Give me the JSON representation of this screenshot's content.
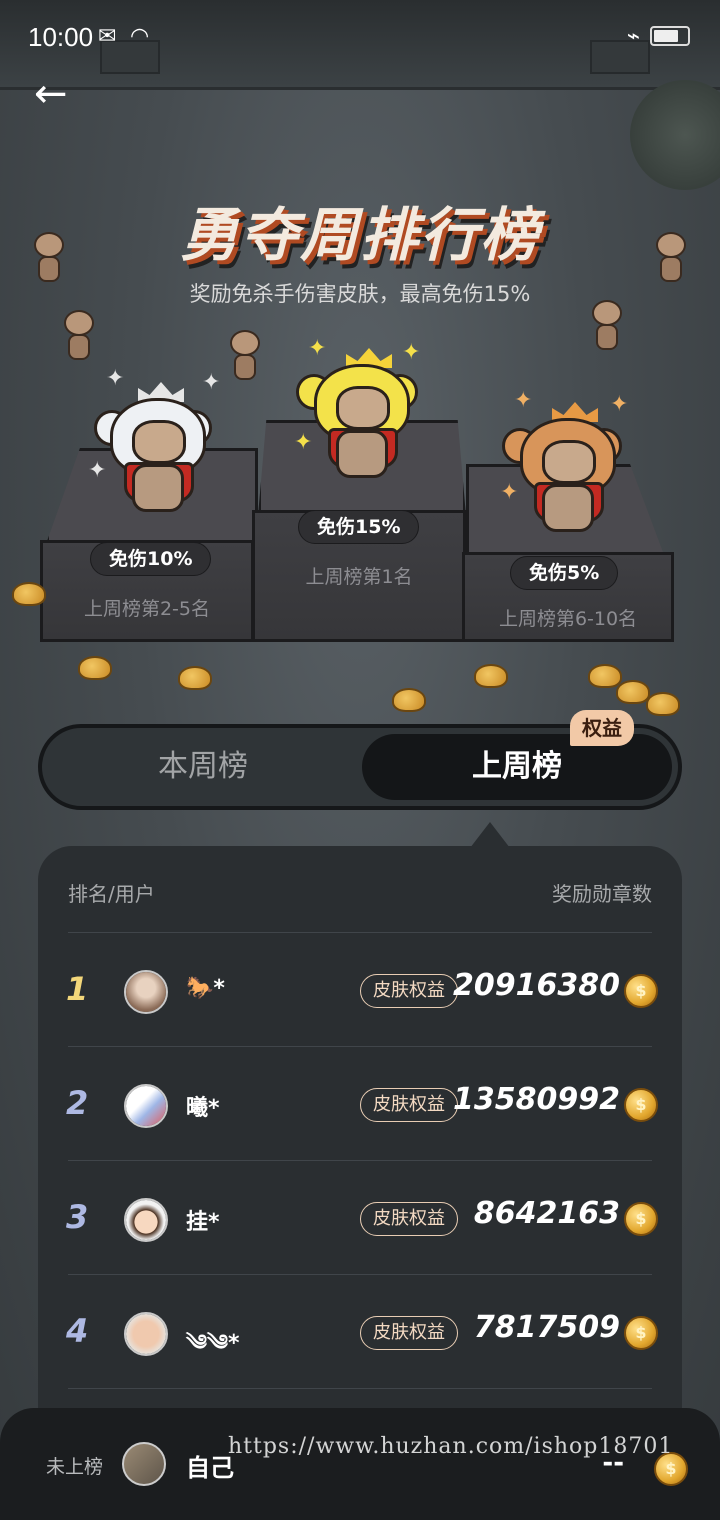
{
  "status_bar": {
    "time": "10:00"
  },
  "hero": {
    "title": "勇夺周排行榜",
    "subtitle": "奖励免杀手伤害皮肤，最高免伤15%"
  },
  "podium": [
    {
      "badge": "免伤10%",
      "caption": "上周榜第2-5名"
    },
    {
      "badge": "免伤15%",
      "caption": "上周榜第1名"
    },
    {
      "badge": "免伤5%",
      "caption": "上周榜第6-10名"
    }
  ],
  "tabs": {
    "this_week": "本周榜",
    "last_week": "上周榜",
    "badge": "权益"
  },
  "table": {
    "header_left": "排名/用户",
    "header_right": "奖励勋章数",
    "rows": [
      {
        "rank": "1",
        "name": "🐎*",
        "tag": "皮肤权益",
        "score": "20916380"
      },
      {
        "rank": "2",
        "name": "曦*",
        "tag": "皮肤权益",
        "score": "13580992"
      },
      {
        "rank": "3",
        "name": "挂*",
        "tag": "皮肤权益",
        "score": "8642163"
      },
      {
        "rank": "4",
        "name": "༄༄*",
        "tag": "皮肤权益",
        "score": "7817509"
      }
    ]
  },
  "self": {
    "status": "未上榜",
    "name": "自己",
    "score": "--"
  },
  "watermark": "https://www.huzhan.com/ishop18701",
  "colors": {
    "accent_tag": "#f2c9a7",
    "gold": "#e2a72e",
    "rank1": "#f3d77a",
    "rank_other": "#aeb9e3"
  }
}
